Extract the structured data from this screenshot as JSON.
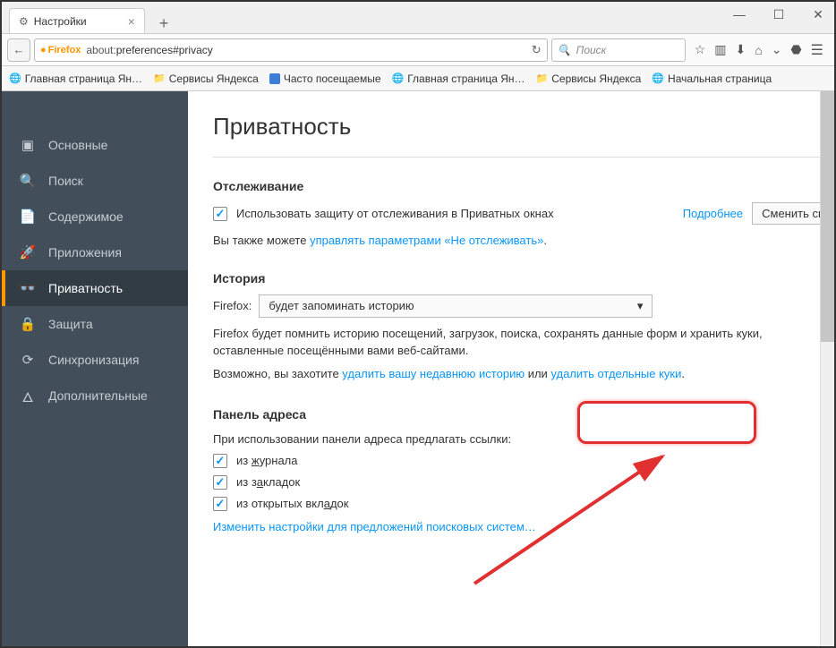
{
  "window": {
    "tab_title": "Настройки"
  },
  "urlbar": {
    "brand": "Firefox",
    "host": "about:",
    "path": "preferences#privacy"
  },
  "searchbox": {
    "placeholder": "Поиск"
  },
  "bookmarks": [
    "Главная страница Ян…",
    "Сервисы Яндекса",
    "Часто посещаемые",
    "Главная страница Ян…",
    "Сервисы Яндекса",
    "Начальная страница"
  ],
  "sidebar": {
    "items": [
      {
        "label": "Основные",
        "icon": "▣"
      },
      {
        "label": "Поиск",
        "icon": "🔍"
      },
      {
        "label": "Содержимое",
        "icon": "📄"
      },
      {
        "label": "Приложения",
        "icon": "🚀"
      },
      {
        "label": "Приватность",
        "icon": "👓"
      },
      {
        "label": "Защита",
        "icon": "🔒"
      },
      {
        "label": "Синхронизация",
        "icon": "⟳"
      },
      {
        "label": "Дополнительные",
        "icon": "🜂"
      }
    ],
    "active_index": 4
  },
  "page": {
    "heading": "Приватность",
    "tracking": {
      "title": "Отслеживание",
      "checkbox_label": "Использовать защиту от отслеживания в Приватных окнах",
      "learn_more": "Подробнее",
      "change_button": "Сменить сп",
      "also_text_pre": "Вы также можете ",
      "also_link": "управлять параметрами «Не отслеживать»",
      "also_text_post": "."
    },
    "history": {
      "title": "История",
      "label": "Firefox:",
      "select_value": "будет запоминать историю",
      "desc": "Firefox будет помнить историю посещений, загрузок, поиска, сохранять данные форм и хранить куки, оставленные посещёнными вами веб-сайтами.",
      "maybe_pre": "Возможно, вы захотите ",
      "link1": "удалить вашу недавнюю историю",
      "mid": " или ",
      "link2": "удалить отдельные куки",
      "post": "."
    },
    "addressbar": {
      "title": "Панель адреса",
      "intro": "При использовании панели адреса предлагать ссылки:",
      "opt1_pre": "из ",
      "opt1_u": "ж",
      "opt1_post": "урнала",
      "opt2_pre": "из з",
      "opt2_u": "а",
      "opt2_post": "кладок",
      "opt3_pre": "из открытых вкл",
      "opt3_u": "а",
      "opt3_post": "док",
      "change_link": "Изменить настройки для предложений поисковых систем…"
    }
  }
}
